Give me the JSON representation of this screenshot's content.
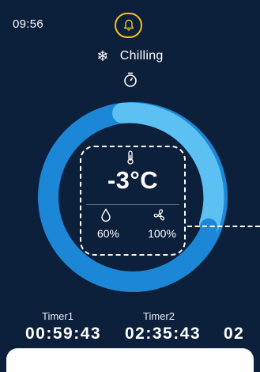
{
  "status_bar": {
    "time": "09:56"
  },
  "header": {
    "mode_label": "Chilling"
  },
  "gauge": {
    "temperature": "-3°C",
    "humidity": "60%",
    "fan_speed": "100%"
  },
  "timers": [
    {
      "label": "Timer1",
      "value": "00:59:43"
    },
    {
      "label": "Timer2",
      "value": "02:35:43"
    },
    {
      "label": "",
      "value": "02"
    }
  ],
  "colors": {
    "background": "#0c1f3b",
    "ring_dark": "#1c87d6",
    "ring_light": "#5cc0f2",
    "bell_accent": "#f0c419"
  },
  "icons": [
    "bell-icon",
    "snowflake-icon",
    "stopwatch-icon",
    "thermometer-icon",
    "droplet-icon",
    "fan-icon"
  ]
}
